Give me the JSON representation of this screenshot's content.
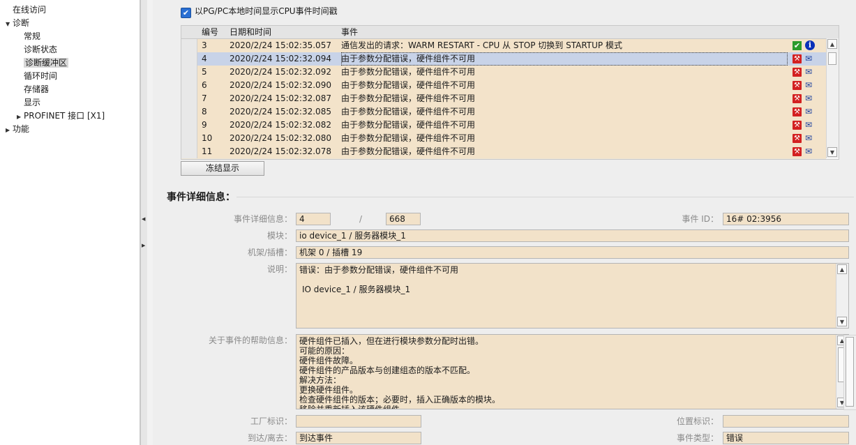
{
  "nav": {
    "items": [
      {
        "label": "在线访问",
        "level": 0,
        "expander": "",
        "selected": false
      },
      {
        "label": "诊断",
        "level": 0,
        "expander": "expanded",
        "selected": false
      },
      {
        "label": "常规",
        "level": 1,
        "expander": "",
        "selected": false
      },
      {
        "label": "诊断状态",
        "level": 1,
        "expander": "",
        "selected": false
      },
      {
        "label": "诊断缓冲区",
        "level": 1,
        "expander": "",
        "selected": true
      },
      {
        "label": "循环时间",
        "level": 1,
        "expander": "",
        "selected": false
      },
      {
        "label": "存储器",
        "level": 1,
        "expander": "",
        "selected": false
      },
      {
        "label": "显示",
        "level": 1,
        "expander": "",
        "selected": false
      },
      {
        "label": "PROFINET 接口 [X1]",
        "level": 1,
        "expander": "collapsed",
        "selected": false
      },
      {
        "label": "功能",
        "level": 0,
        "expander": "collapsed",
        "selected": false
      }
    ]
  },
  "options": {
    "show_pgpc_time_label": "以PG/PC本地时间显示CPU事件时间戳",
    "show_pgpc_time_checked": true
  },
  "table": {
    "headers": {
      "num": "编号",
      "datetime": "日期和时间",
      "event": "事件"
    },
    "rows": [
      {
        "num": "3",
        "datetime": "2020/2/24 15:02:35.057",
        "event": "通信发出的请求：WARM RESTART - CPU 从 STOP 切换到 STARTUP 模式",
        "status": "ok",
        "selected": false
      },
      {
        "num": "4",
        "datetime": "2020/2/24 15:02:32.094",
        "event": "由于参数分配错误，硬件组件不可用",
        "status": "error",
        "selected": true
      },
      {
        "num": "5",
        "datetime": "2020/2/24 15:02:32.092",
        "event": "由于参数分配错误，硬件组件不可用",
        "status": "error",
        "selected": false
      },
      {
        "num": "6",
        "datetime": "2020/2/24 15:02:32.090",
        "event": "由于参数分配错误，硬件组件不可用",
        "status": "error",
        "selected": false
      },
      {
        "num": "7",
        "datetime": "2020/2/24 15:02:32.087",
        "event": "由于参数分配错误，硬件组件不可用",
        "status": "error",
        "selected": false
      },
      {
        "num": "8",
        "datetime": "2020/2/24 15:02:32.085",
        "event": "由于参数分配错误，硬件组件不可用",
        "status": "error",
        "selected": false
      },
      {
        "num": "9",
        "datetime": "2020/2/24 15:02:32.082",
        "event": "由于参数分配错误，硬件组件不可用",
        "status": "error",
        "selected": false
      },
      {
        "num": "10",
        "datetime": "2020/2/24 15:02:32.080",
        "event": "由于参数分配错误，硬件组件不可用",
        "status": "error",
        "selected": false
      },
      {
        "num": "11",
        "datetime": "2020/2/24 15:02:32.078",
        "event": "由于参数分配错误，硬件组件不可用",
        "status": "error",
        "selected": false
      }
    ]
  },
  "freeze_button_label": "冻结显示",
  "details": {
    "title": "事件详细信息：",
    "event_detail_label": "事件详细信息：",
    "event_index": "4",
    "separator": "/",
    "event_total": "668",
    "event_id_label": "事件 ID：",
    "event_id": "16# 02:3956",
    "module_label": "模块：",
    "module": "io device_1 / 服务器模块_1",
    "rack_slot_label": "机架/插槽：",
    "rack_slot": "机架 0 / 插槽 19",
    "description_label": "说明：",
    "description_lines": [
      "错误：由于参数分配错误，硬件组件不可用",
      "",
      "IO device_1 / 服务器模块_1"
    ],
    "help_label": "关于事件的帮助信息：",
    "help_lines": [
      "硬件组件已插入，但在进行模块参数分配时出错。",
      "可能的原因：",
      "硬件组件故障。",
      "硬件组件的产品版本与创建组态的版本不匹配。",
      "解决方法：",
      "更换硬件组件。",
      "检查硬件组件的版本；必要时，插入正确版本的模块。",
      "移除并重新插入该硬件组件。"
    ],
    "plant_id_label": "工厂标识：",
    "plant_id": "",
    "location_id_label": "位置标识：",
    "location_id": "",
    "arrive_leave_label": "到达/离去：",
    "arrive_leave": "到达事件",
    "event_type_label": "事件类型：",
    "event_type": "错误"
  },
  "colors": {
    "field_bg": "#f2e2c9",
    "row_bg": "#f3e3ca",
    "selected_row": "#c8d3e8",
    "error_icon": "#d32020",
    "ok_icon": "#2b9b2b",
    "info_icon": "#0a30b8"
  }
}
